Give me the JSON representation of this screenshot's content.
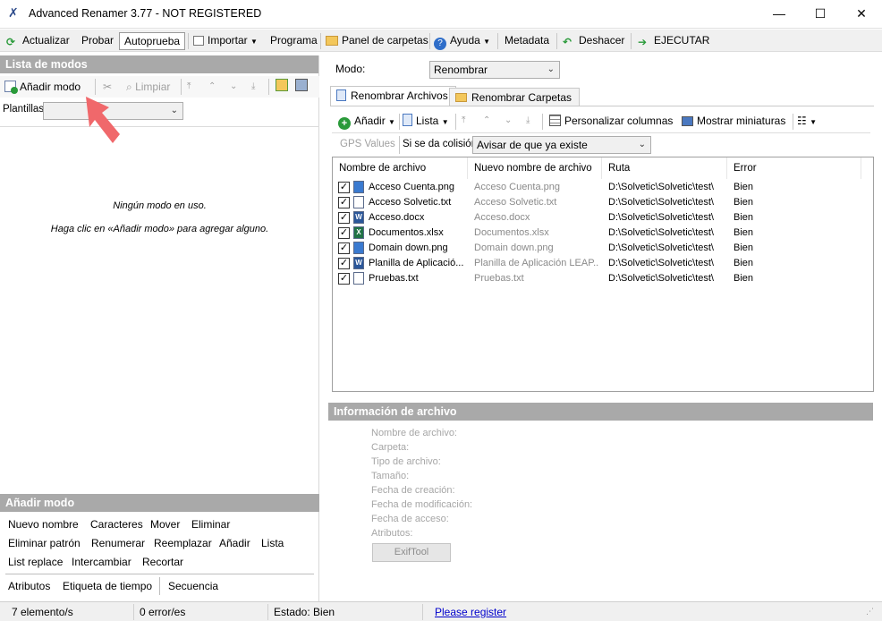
{
  "window": {
    "title": "Advanced Renamer 3.77 - NOT REGISTERED",
    "minimize": "—",
    "maximize": "☐",
    "close": "✕"
  },
  "toolbar": {
    "actualizar": "Actualizar",
    "probar": "Probar",
    "autoprueba": "Autoprueba",
    "importar": "Importar",
    "programa": "Programa",
    "panel_carpetas": "Panel de carpetas",
    "ayuda": "Ayuda",
    "metadata": "Metadata",
    "deshacer": "Deshacer",
    "ejecutar": "EJECUTAR"
  },
  "left": {
    "header": "Lista de modos",
    "add_mode": "Añadir modo",
    "limpiar": "Limpiar",
    "plantillas_label": "Plantillas:",
    "plantillas_value": "",
    "empty_line1": "Ningún modo en uso.",
    "empty_line2": "Haga clic en «Añadir modo» para agregar alguno.",
    "add_header": "Añadir modo",
    "modes_row1": [
      "Nuevo nombre",
      "Caracteres",
      "Mover",
      "Eliminar"
    ],
    "modes_row2": [
      "Eliminar patrón",
      "Renumerar",
      "Reemplazar",
      "Añadir",
      "Lista"
    ],
    "modes_row3": [
      "List replace",
      "Intercambiar",
      "Recortar"
    ],
    "modes_row4": [
      "Atributos",
      "Etiqueta de tiempo",
      "Secuencia"
    ]
  },
  "right": {
    "modo_label": "Modo:",
    "modo_value": "Renombrar",
    "tabs": [
      "Renombrar Archivos",
      "Renombrar Carpetas"
    ],
    "anadir": "Añadir",
    "lista": "Lista",
    "personalizar": "Personalizar columnas",
    "miniaturas": "Mostrar miniaturas",
    "gps": "GPS Values",
    "colision_label": "Si se da colisión:",
    "colision_value": "Avisar de que ya existe",
    "columns": [
      "Nombre de archivo",
      "Nuevo nombre de archivo",
      "Ruta",
      "Error"
    ],
    "files": [
      {
        "name": "Acceso Cuenta.png",
        "new": "Acceso Cuenta.png",
        "path": "D:\\Solvetic\\Solvetic\\test\\",
        "error": "Bien",
        "icon": "image-file-icon"
      },
      {
        "name": "Acceso Solvetic.txt",
        "new": "Acceso Solvetic.txt",
        "path": "D:\\Solvetic\\Solvetic\\test\\",
        "error": "Bien",
        "icon": "text-file-icon"
      },
      {
        "name": "Acceso.docx",
        "new": "Acceso.docx",
        "path": "D:\\Solvetic\\Solvetic\\test\\",
        "error": "Bien",
        "icon": "word-file-icon"
      },
      {
        "name": "Documentos.xlsx",
        "new": "Documentos.xlsx",
        "path": "D:\\Solvetic\\Solvetic\\test\\",
        "error": "Bien",
        "icon": "excel-file-icon"
      },
      {
        "name": "Domain down.png",
        "new": "Domain down.png",
        "path": "D:\\Solvetic\\Solvetic\\test\\",
        "error": "Bien",
        "icon": "image-file-icon"
      },
      {
        "name": "Planilla de Aplicació...",
        "new": "Planilla de Aplicación LEAP...",
        "path": "D:\\Solvetic\\Solvetic\\test\\",
        "error": "Bien",
        "icon": "word-file-icon"
      },
      {
        "name": "Pruebas.txt",
        "new": "Pruebas.txt",
        "path": "D:\\Solvetic\\Solvetic\\test\\",
        "error": "Bien",
        "icon": "text-file-icon"
      }
    ],
    "info_header": "Información de archivo",
    "info_labels": [
      "Nombre de archivo:",
      "Carpeta:",
      "Tipo de archivo:",
      "Tamaño:",
      "Fecha de creación:",
      "Fecha de modificación:",
      "Fecha de acceso:",
      "Atributos:"
    ],
    "exiftool": "ExifTool"
  },
  "status": {
    "elements": "7 elemento/s",
    "errors": "0 error/es",
    "estado": "Estado: Bien",
    "register": "Please register"
  },
  "colors": {
    "panel_header": "#a9a9a9",
    "arrow": "#f0686b",
    "link": "#0000cc"
  }
}
